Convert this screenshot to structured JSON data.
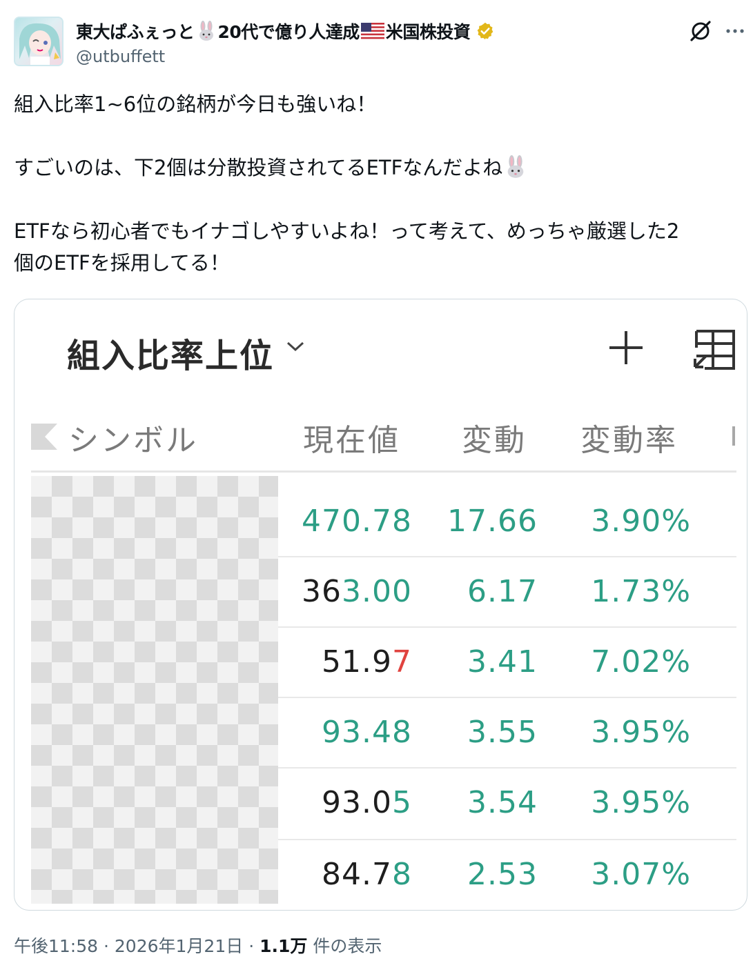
{
  "author": {
    "display_name_part1": "東大ぱふぇっと",
    "display_name_part2": "20代で億り人達成",
    "display_name_part3": "米国株投資",
    "handle": "@utbuffett"
  },
  "post": {
    "line1": "組入比率1~6位の銘柄が今日も強いね！",
    "line2": "すごいのは、下2個は分散投資されてるETFなんだよね",
    "line3": "ETFなら初心者でもイナゴしやすいよね！って考えて、めっちゃ厳選した2",
    "line4": "個のETFを採用してる！"
  },
  "table": {
    "title": "組入比率上位",
    "headers": {
      "symbol": "シンボル",
      "price": "現在値",
      "change": "変動",
      "change_pct": "変動率"
    },
    "rows": [
      {
        "price_a": "",
        "price_b": "470.78",
        "change": "17.66",
        "pct": "3.90%"
      },
      {
        "price_a": "36",
        "price_b": "3.00",
        "change": "6.17",
        "pct": "1.73%"
      },
      {
        "price_a": "51.9",
        "price_b": "7",
        "change": "3.41",
        "pct": "7.02%"
      },
      {
        "price_a": "",
        "price_b": "93.48",
        "change": "3.55",
        "pct": "3.95%"
      },
      {
        "price_a": "93.0",
        "price_b": "5",
        "change": "3.54",
        "pct": "3.95%"
      },
      {
        "price_a": "84.7",
        "price_b": "8",
        "change": "2.53",
        "pct": "3.07%"
      }
    ]
  },
  "footer": {
    "time": "午後11:58",
    "sep1": "·",
    "date": "2026年1月21日",
    "sep2": "·",
    "views": "1.1万",
    "views_label": "件の表示"
  },
  "colors": {
    "green": "#2c9e85",
    "red": "#e0433f",
    "verified": "#e2b719"
  },
  "icons": [
    "rabbit-icon",
    "us-flag-icon",
    "verified-badge-icon",
    "grok-icon",
    "more-icon",
    "chevron-down-icon",
    "plus-icon",
    "table-layout-icon"
  ]
}
